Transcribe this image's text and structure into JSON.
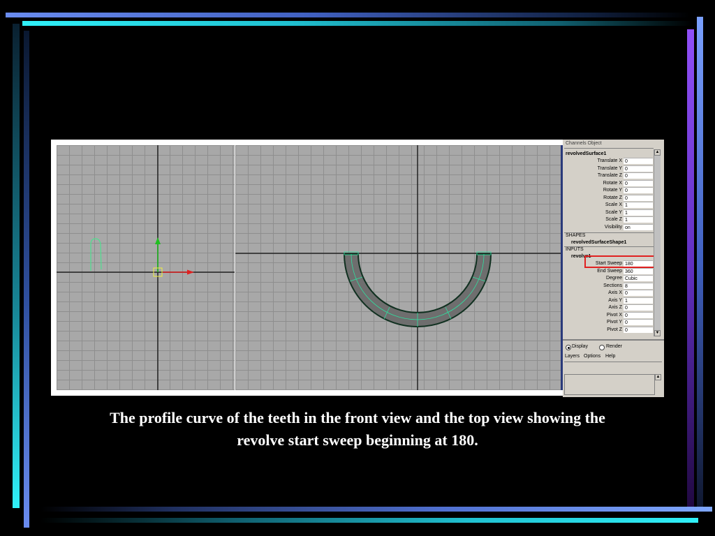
{
  "caption": {
    "line1": "The profile curve of the teeth in the front view and the top view showing the",
    "line2": "revolve start sweep beginning at 180."
  },
  "channel_box": {
    "header": "Channels  Object",
    "node_name": "revolvedSurface1",
    "transform_attrs": [
      {
        "label": "Translate X",
        "value": "0"
      },
      {
        "label": "Translate Y",
        "value": "0"
      },
      {
        "label": "Translate Z",
        "value": "0"
      },
      {
        "label": "Rotate X",
        "value": "0"
      },
      {
        "label": "Rotate Y",
        "value": "0"
      },
      {
        "label": "Rotate Z",
        "value": "0"
      },
      {
        "label": "Scale X",
        "value": "1"
      },
      {
        "label": "Scale Y",
        "value": "1"
      },
      {
        "label": "Scale Z",
        "value": "1"
      },
      {
        "label": "Visibility",
        "value": "on"
      }
    ],
    "shapes_heading": "SHAPES",
    "shape_name": "revolvedSurfaceShape1",
    "inputs_heading": "INPUTS",
    "input_name": "revolve1",
    "revolve_attrs": [
      {
        "label": "Start Sweep",
        "value": "180"
      },
      {
        "label": "End Sweep",
        "value": "360"
      },
      {
        "label": "Degree",
        "value": "Cubic"
      },
      {
        "label": "Sections",
        "value": "8"
      },
      {
        "label": "Axis X",
        "value": "0"
      },
      {
        "label": "Axis Y",
        "value": "1"
      },
      {
        "label": "Axis Z",
        "value": "0"
      },
      {
        "label": "Pivot X",
        "value": "0"
      },
      {
        "label": "Pivot Y",
        "value": "0"
      },
      {
        "label": "Pivot Z",
        "value": "0"
      }
    ],
    "highlight_color": "#e02020"
  },
  "layer_panel": {
    "display_label": "Display",
    "render_label": "Render",
    "selected": "Display",
    "menu": [
      "Layers",
      "Options",
      "Help"
    ]
  },
  "colors": {
    "viewport_bg": "#a8a8a8",
    "grid": "#8e8e8e",
    "profile_curve": "#50e090",
    "manipulator_y": "#20c020",
    "manipulator_x": "#e02020",
    "manipulator_center": "#f0f040",
    "surface": "#707070",
    "surface_edges": "#30e0a0"
  },
  "icons": {
    "scroll_up": "arrow-up-icon",
    "scroll_down": "arrow-down-icon"
  }
}
